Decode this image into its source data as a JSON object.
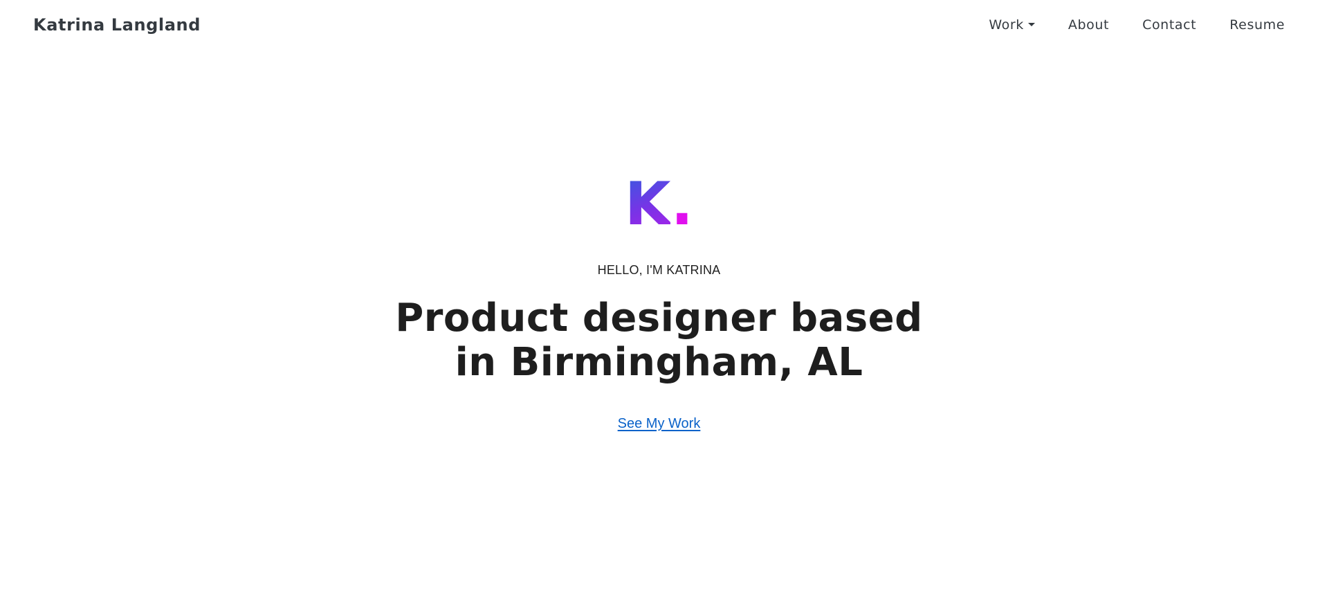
{
  "header": {
    "brand": "Katrina Langland",
    "nav": {
      "work": "Work",
      "about": "About",
      "contact": "Contact",
      "resume": "Resume"
    },
    "work_dropdown_icon": "caret-down-icon"
  },
  "hero": {
    "logo_letter": "K",
    "logo_dot": ".",
    "eyebrow": "HELLO, I'M KATRINA",
    "headline_line1": "Product designer based",
    "headline_line2": "in Birmingham, AL",
    "cta_label": "See My Work"
  },
  "colors": {
    "text": "#1e1e1e",
    "nav_text": "#343a40",
    "link": "#0a62c9",
    "logo_gradient_start": "#2f5fe0",
    "logo_gradient_end": "#b020ea",
    "logo_dot": "#e010ee",
    "background": "#ffffff"
  }
}
